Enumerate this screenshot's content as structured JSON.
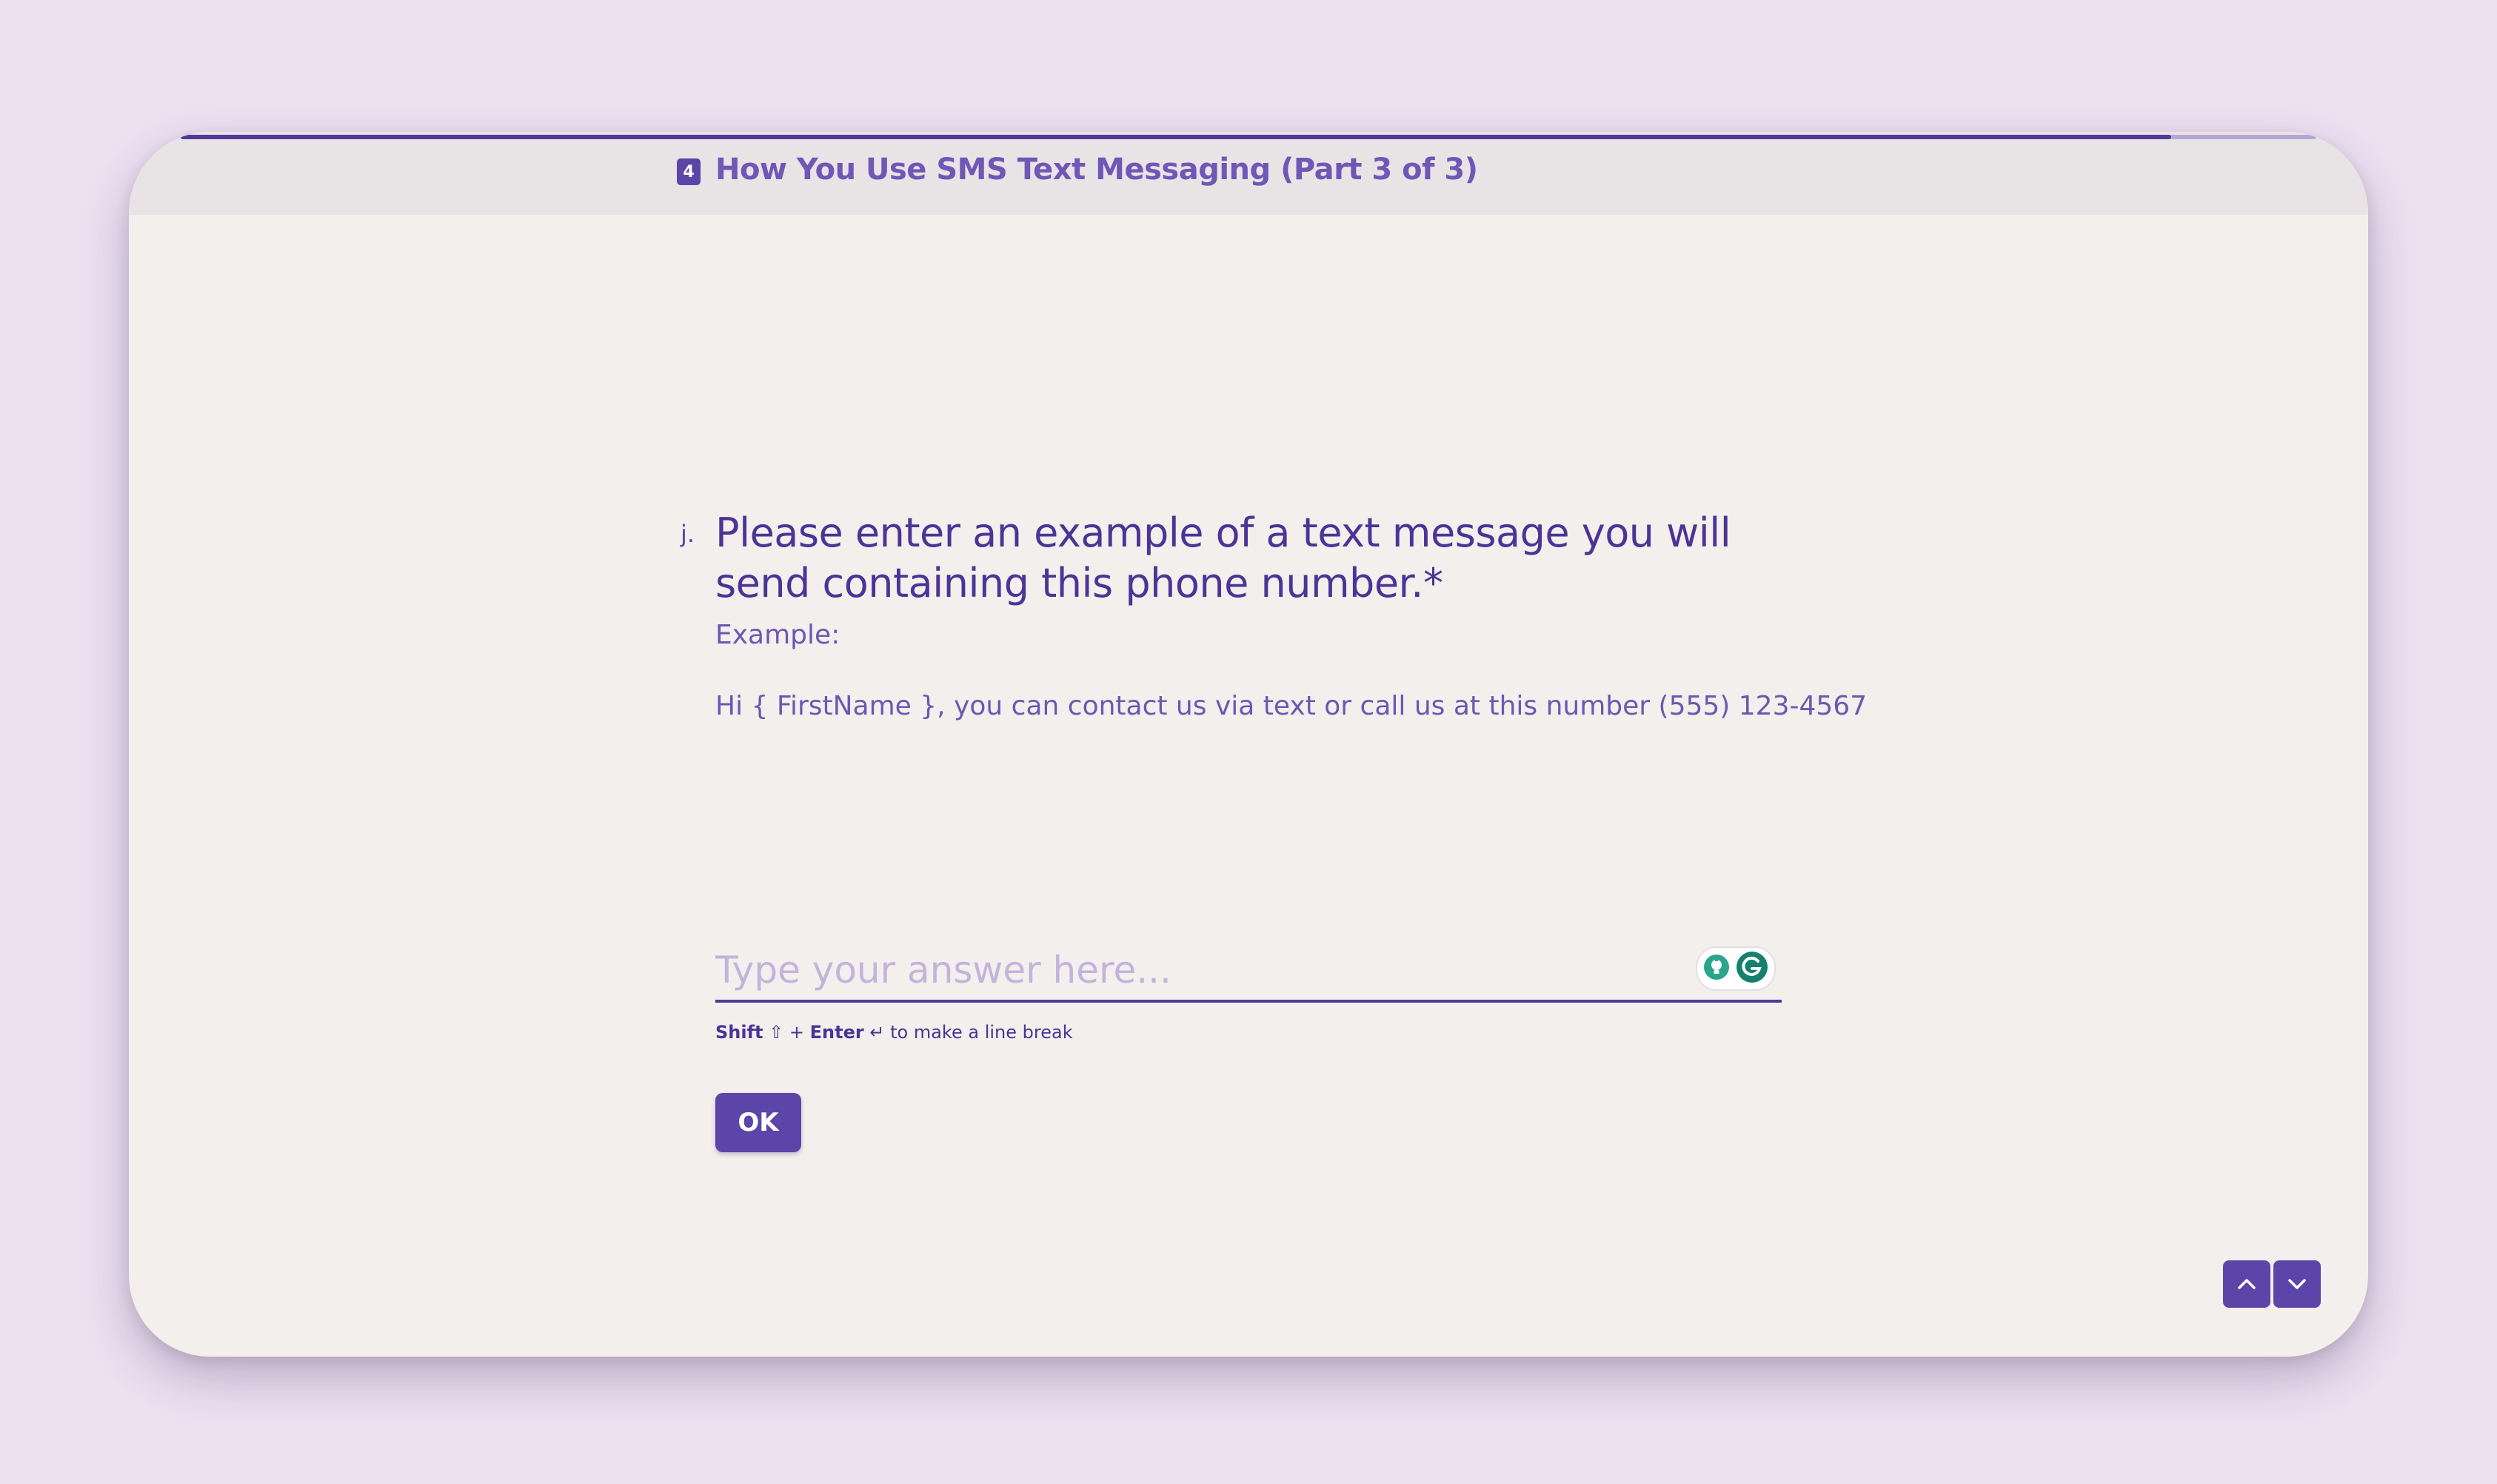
{
  "header": {
    "progress_fraction": 0.932,
    "section_number": "4",
    "section_title": "How You Use SMS Text Messaging (Part 3 of 3)"
  },
  "question": {
    "letter": "j.",
    "title": "Please enter an example of a text message you will send containing this phone number.*",
    "description_label": "Example:",
    "description_example": "Hi { FirstName }, you can contact us via text or call us at this number (555) 123-4567"
  },
  "answer": {
    "placeholder": "Type your answer here...",
    "value": ""
  },
  "hint": {
    "shift": "Shift",
    "shift_symbol": "⇧",
    "plus": "+",
    "enter": "Enter",
    "enter_symbol": "↵",
    "suffix": "to make a line break"
  },
  "ok_label": "OK",
  "icons": {
    "extension_1": "lightbulb-icon",
    "extension_2": "grammarly-icon",
    "nav_up": "chevron-up-icon",
    "nav_down": "chevron-down-icon"
  },
  "colors": {
    "accent": "#5b45a8",
    "title_text": "#4a3596",
    "background": "#ede1f2",
    "panel": "#f2efed"
  }
}
